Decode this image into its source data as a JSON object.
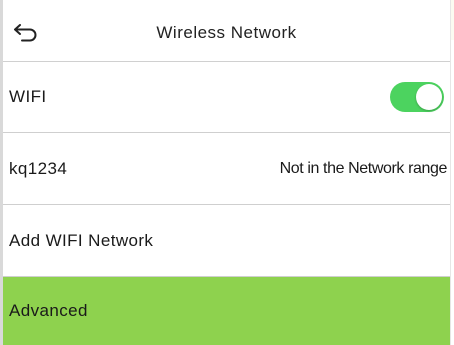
{
  "header": {
    "title": "Wireless Network",
    "back_icon": "back-arrow-icon"
  },
  "rows": [
    {
      "label": "WIFI",
      "control": "toggle",
      "toggle_on": true
    },
    {
      "label": "kq1234",
      "value": "Not in the Network range"
    },
    {
      "label": "Add WIFI Network"
    },
    {
      "label": "Advanced",
      "highlighted": true
    }
  ],
  "colors": {
    "toggle_on": "#4cd35f",
    "highlight": "#8ed24e",
    "divider": "#cfcfcf",
    "text": "#1a1a1a"
  }
}
